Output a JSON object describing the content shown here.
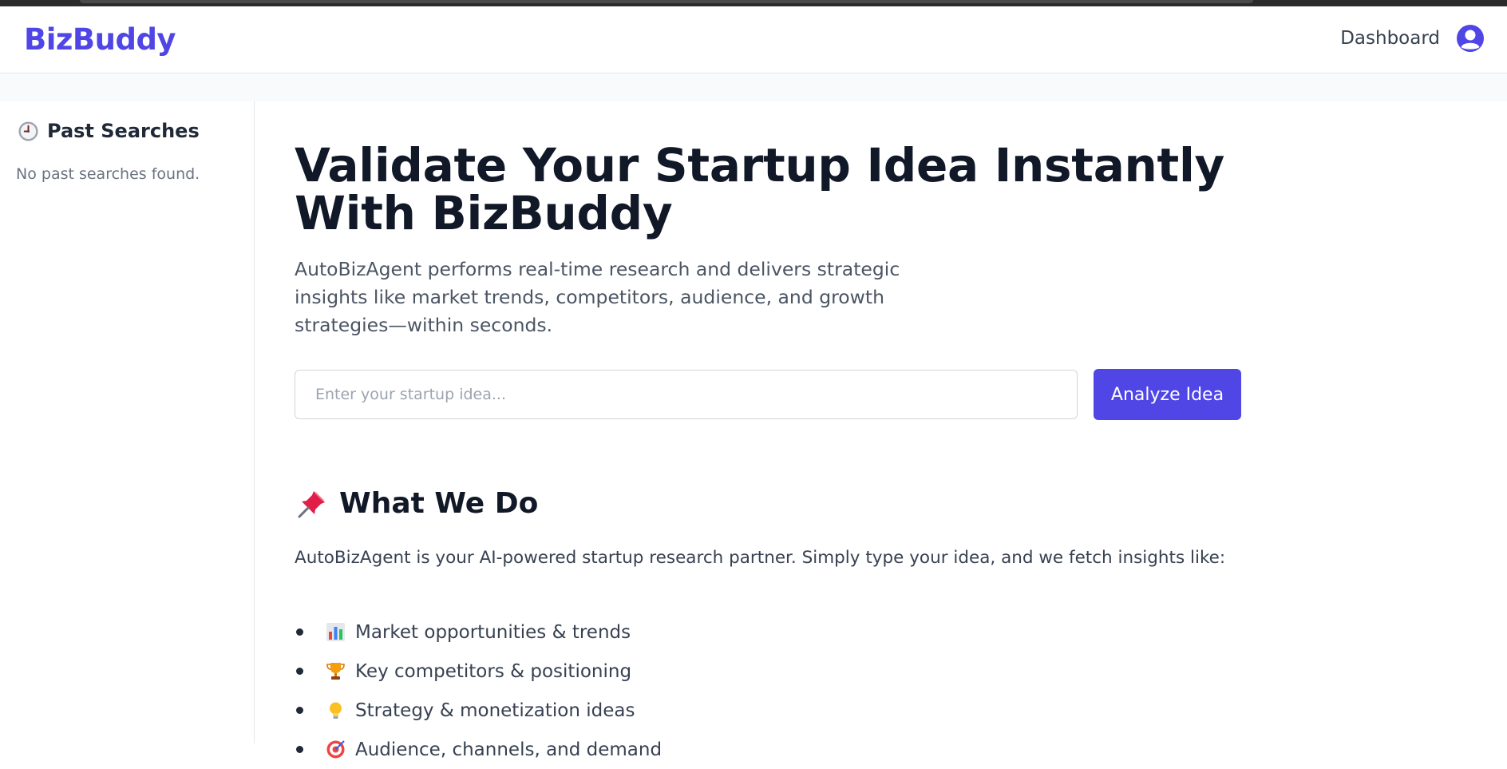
{
  "header": {
    "logo": "BizBuddy",
    "nav_link": "Dashboard",
    "avatar_icon": "user-avatar-icon",
    "brand_color": "#4f46e5"
  },
  "sidebar": {
    "title": "Past Searches",
    "title_icon": "clock-icon",
    "empty_text": "No past searches found."
  },
  "hero": {
    "title": "Validate Your Startup Idea Instantly With BizBuddy",
    "subtitle": "AutoBizAgent performs real-time research and delivers strategic insights like market trends, competitors, audience, and growth strategies—within seconds."
  },
  "search": {
    "placeholder": "Enter your startup idea...",
    "value": "",
    "button_label": "Analyze Idea"
  },
  "what_we_do": {
    "icon": "pushpin-icon",
    "title": "What We Do",
    "description": "AutoBizAgent is your AI-powered startup research partner. Simply type your idea, and we fetch insights like:",
    "items": [
      {
        "icon": "bar-chart-icon",
        "label": "Market opportunities & trends"
      },
      {
        "icon": "trophy-icon",
        "label": "Key competitors & positioning"
      },
      {
        "icon": "lightbulb-icon",
        "label": "Strategy & monetization ideas"
      },
      {
        "icon": "target-icon",
        "label": "Audience, channels, and demand"
      }
    ]
  }
}
